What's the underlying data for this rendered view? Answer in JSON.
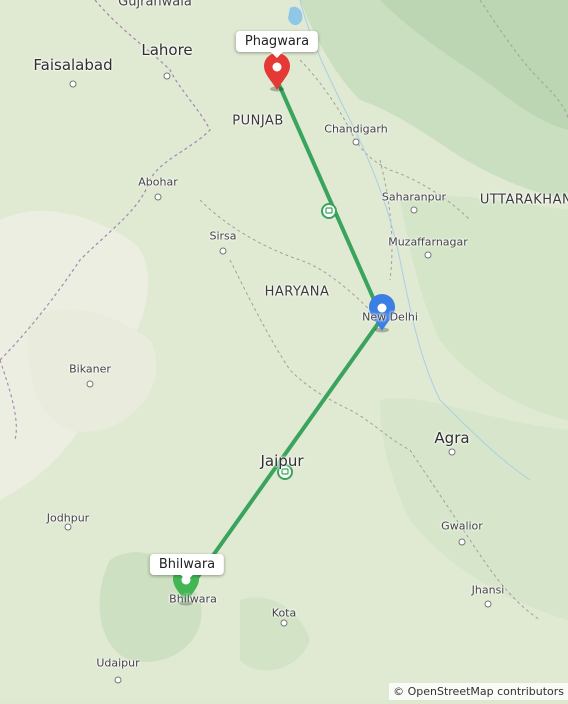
{
  "map": {
    "route_color": "#3aa35d",
    "labels": {
      "gujranwala": "Gujranwala",
      "lahore": "Lahore",
      "faisalabad": "Faisalabad",
      "punjab": "PUNJAB",
      "chandigarh": "Chandigarh",
      "abohar": "Abohar",
      "saharanpur": "Saharanpur",
      "uttarakhand": "UTTARAKHAN",
      "sirsa": "Sirsa",
      "muzaffarnagar": "Muzaffarnagar",
      "haryana": "HARYANA",
      "new_delhi": "New Delhi",
      "bikaner": "Bikaner",
      "agra": "Agra",
      "jaipur": "Jaipur",
      "jodhpur": "Jodhpur",
      "gwalior": "Gwalior",
      "bhilwara": "Bhilwara",
      "kota": "Kota",
      "jhansi": "Jhansi",
      "udaipur": "Udaipur"
    },
    "markers": {
      "origin_label": "Phagwara",
      "destination_label": "Bhilwara"
    },
    "attribution": "© OpenStreetMap contributors"
  }
}
